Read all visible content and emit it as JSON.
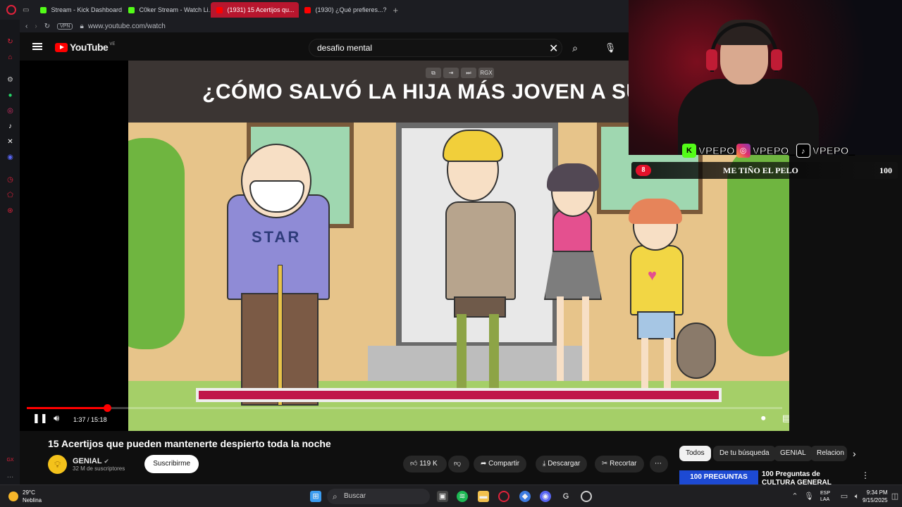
{
  "browser": {
    "tabs": [
      {
        "label": "Stream - Kick Dashboard",
        "favicon": "kick"
      },
      {
        "label": "C0ker Stream - Watch Li...",
        "favicon": "kick"
      },
      {
        "label": "(1931) 15 Acertijos qu...",
        "favicon": "youtube",
        "active": true
      },
      {
        "label": "(1930) ¿Qué prefieres...?",
        "favicon": "youtube"
      }
    ],
    "url": "www.youtube.com/watch",
    "vpn_label": "VPN"
  },
  "youtube": {
    "logo_text": "YouTube",
    "country_code": "VE",
    "search_value": "desafio mental",
    "video_overlay_title": "¿CÓMO SALVÓ LA HIJA MÁS JOVEN A SU",
    "player": {
      "current_time": "1:37",
      "separator": " / ",
      "duration": "15:18",
      "progress_fraction": 0.106,
      "ctrl_top_label": "RGX"
    },
    "video": {
      "title": "15 Acertijos que pueden mantenerte despierto toda la noche",
      "shirt_text": "STAR"
    },
    "channel": {
      "name": "GENIAL",
      "subscribers": "32 M de suscriptores",
      "subscribe_label": "Suscribirme"
    },
    "actions": {
      "likes": "119 K",
      "share": "Compartir",
      "download": "Descargar",
      "clip": "Recortar"
    },
    "chips": [
      "Todos",
      "De tu búsqueda",
      "GENIAL",
      "Relacion"
    ],
    "recommendation": {
      "thumb_text": "100 PREGUNTAS",
      "title": "100 Preguntas de CULTURA GENERAL"
    }
  },
  "stream_overlay": {
    "socials": [
      {
        "platform": "kick",
        "handle": "VPEPO"
      },
      {
        "platform": "instagram",
        "handle": "VPEPO_"
      },
      {
        "platform": "tiktok",
        "handle": "VPEPO_"
      }
    ],
    "goal": {
      "current": "8",
      "text": "ME TIÑO EL PELO",
      "target": "100"
    }
  },
  "taskbar": {
    "weather_temp": "29°C",
    "weather_desc": "Neblina",
    "search_label": "Buscar",
    "lang_1": "ESP",
    "lang_2": "LAA",
    "time": "9:34 PM",
    "date": "9/15/2025"
  },
  "colors": {
    "youtube_red": "#ff0000",
    "opera_red": "#b8162e",
    "kick_green": "#53fc18",
    "goal_red": "#e3122b",
    "video_bar": "#c0174a"
  }
}
